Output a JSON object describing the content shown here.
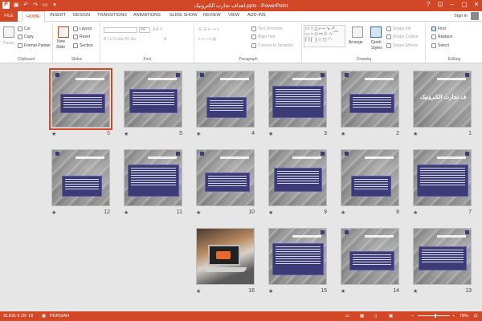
{
  "titlebar": {
    "title": "اهداف تجارت الکترونیک.pptx - PowerPoint",
    "logo": "P",
    "help": "?",
    "minimize": "–",
    "maximize": "▢",
    "close": "✕"
  },
  "tabs": [
    "FILE",
    "HOME",
    "INSERT",
    "DESIGN",
    "TRANSITIONS",
    "ANIMATIONS",
    "SLIDE SHOW",
    "REVIEW",
    "VIEW",
    "ADD-INS"
  ],
  "active_tab": "HOME",
  "signin": "Sign in",
  "ribbon": {
    "clipboard": {
      "label": "Clipboard",
      "paste": "Paste",
      "cut": "Cut",
      "copy": "Copy",
      "format_painter": "Format Painter"
    },
    "slides": {
      "label": "Slides",
      "new_slide": "New",
      "new_slide2": "Slide",
      "layout": "Layout",
      "reset": "Reset",
      "section": "Section"
    },
    "font": {
      "label": "Font",
      "font_size": "54"
    },
    "paragraph": {
      "label": "Paragraph",
      "text_direction": "Text Direction",
      "align_text": "Align Text",
      "convert_smartart": "Convert to SmartArt"
    },
    "drawing": {
      "label": "Drawing",
      "arrange": "Arrange",
      "quick_styles": "Quick",
      "quick_styles2": "Styles",
      "shape_fill": "Shape Fill",
      "shape_outline": "Shape Outline",
      "shape_effects": "Shape Effects"
    },
    "editing": {
      "label": "Editing",
      "find": "Find",
      "replace": "Replace",
      "select": "Select"
    }
  },
  "slides": [
    {
      "n": "1",
      "kind": "title",
      "title": "اهداف تجارت الکترونیک"
    },
    {
      "n": "2",
      "kind": "text"
    },
    {
      "n": "3",
      "kind": "text"
    },
    {
      "n": "4",
      "kind": "text"
    },
    {
      "n": "5",
      "kind": "text"
    },
    {
      "n": "6",
      "kind": "text",
      "selected": true
    },
    {
      "n": "7",
      "kind": "text"
    },
    {
      "n": "8",
      "kind": "text"
    },
    {
      "n": "9",
      "kind": "text"
    },
    {
      "n": "10",
      "kind": "text"
    },
    {
      "n": "11",
      "kind": "text"
    },
    {
      "n": "12",
      "kind": "text"
    },
    {
      "n": "13",
      "kind": "text"
    },
    {
      "n": "14",
      "kind": "text"
    },
    {
      "n": "15",
      "kind": "text"
    },
    {
      "n": "16",
      "kind": "photo"
    }
  ],
  "star": "★",
  "status": {
    "slide_counter": "SLIDE 6 OF 16",
    "language": "PERSIAN",
    "zoom": "78%",
    "zoom_out": "–",
    "zoom_in": "+"
  },
  "colors": {
    "accent": "#d24726",
    "box": "#3d3a78"
  }
}
